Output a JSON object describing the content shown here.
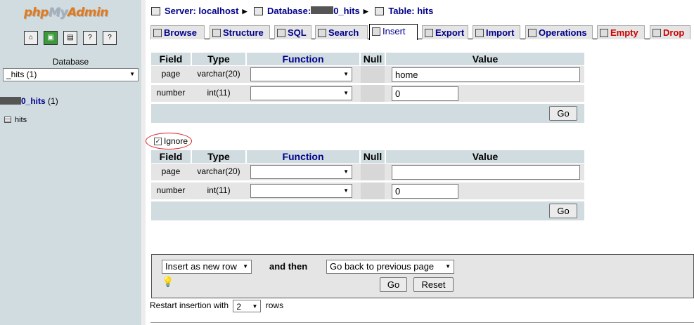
{
  "logo": {
    "part1": "php",
    "part2": "My",
    "part3": "Admin"
  },
  "left_icons": [
    "home-icon",
    "query-window-icon",
    "sql-icon",
    "help-icon",
    "docs-icon"
  ],
  "left": {
    "db_label": "Database",
    "db_select": "_hits (1)",
    "db_link_name": "0_hits",
    "db_link_count": " (1)",
    "table_item": "hits"
  },
  "breadcrumb": {
    "server": "Server: localhost",
    "database_prefix": "Database:",
    "database_suffix": "0_hits",
    "table": "Table: hits"
  },
  "tabs": [
    {
      "label": "Browse"
    },
    {
      "label": "Structure"
    },
    {
      "label": "SQL"
    },
    {
      "label": "Search"
    },
    {
      "label": "Insert"
    },
    {
      "label": "Export"
    },
    {
      "label": "Import"
    },
    {
      "label": "Operations"
    },
    {
      "label": "Empty"
    },
    {
      "label": "Drop"
    }
  ],
  "headers": {
    "field": "Field",
    "type": "Type",
    "function": "Function",
    "null": "Null",
    "value": "Value"
  },
  "form1": {
    "rows": [
      {
        "field": "page",
        "type": "varchar(20)",
        "function": "",
        "value": "home"
      },
      {
        "field": "number",
        "type": "int(11)",
        "function": "",
        "value": "0"
      }
    ],
    "go": "Go"
  },
  "ignore_label": "Ignore",
  "form2": {
    "rows": [
      {
        "field": "page",
        "type": "varchar(20)",
        "function": "",
        "value": ""
      },
      {
        "field": "number",
        "type": "int(11)",
        "function": "",
        "value": "0"
      }
    ],
    "go": "Go"
  },
  "bottom": {
    "insert_mode": "Insert as new row",
    "and_then": "and then",
    "after_action": "Go back to previous page",
    "go": "Go",
    "reset": "Reset"
  },
  "restart": {
    "prefix": "Restart insertion with",
    "count": "2",
    "suffix": "rows"
  },
  "colors": {
    "header_bg": "#d0dce0",
    "row_bg": "#e5e5e5",
    "link": "#00008b",
    "danger": "#cc0000",
    "logo_orange": "#e07a1f"
  }
}
